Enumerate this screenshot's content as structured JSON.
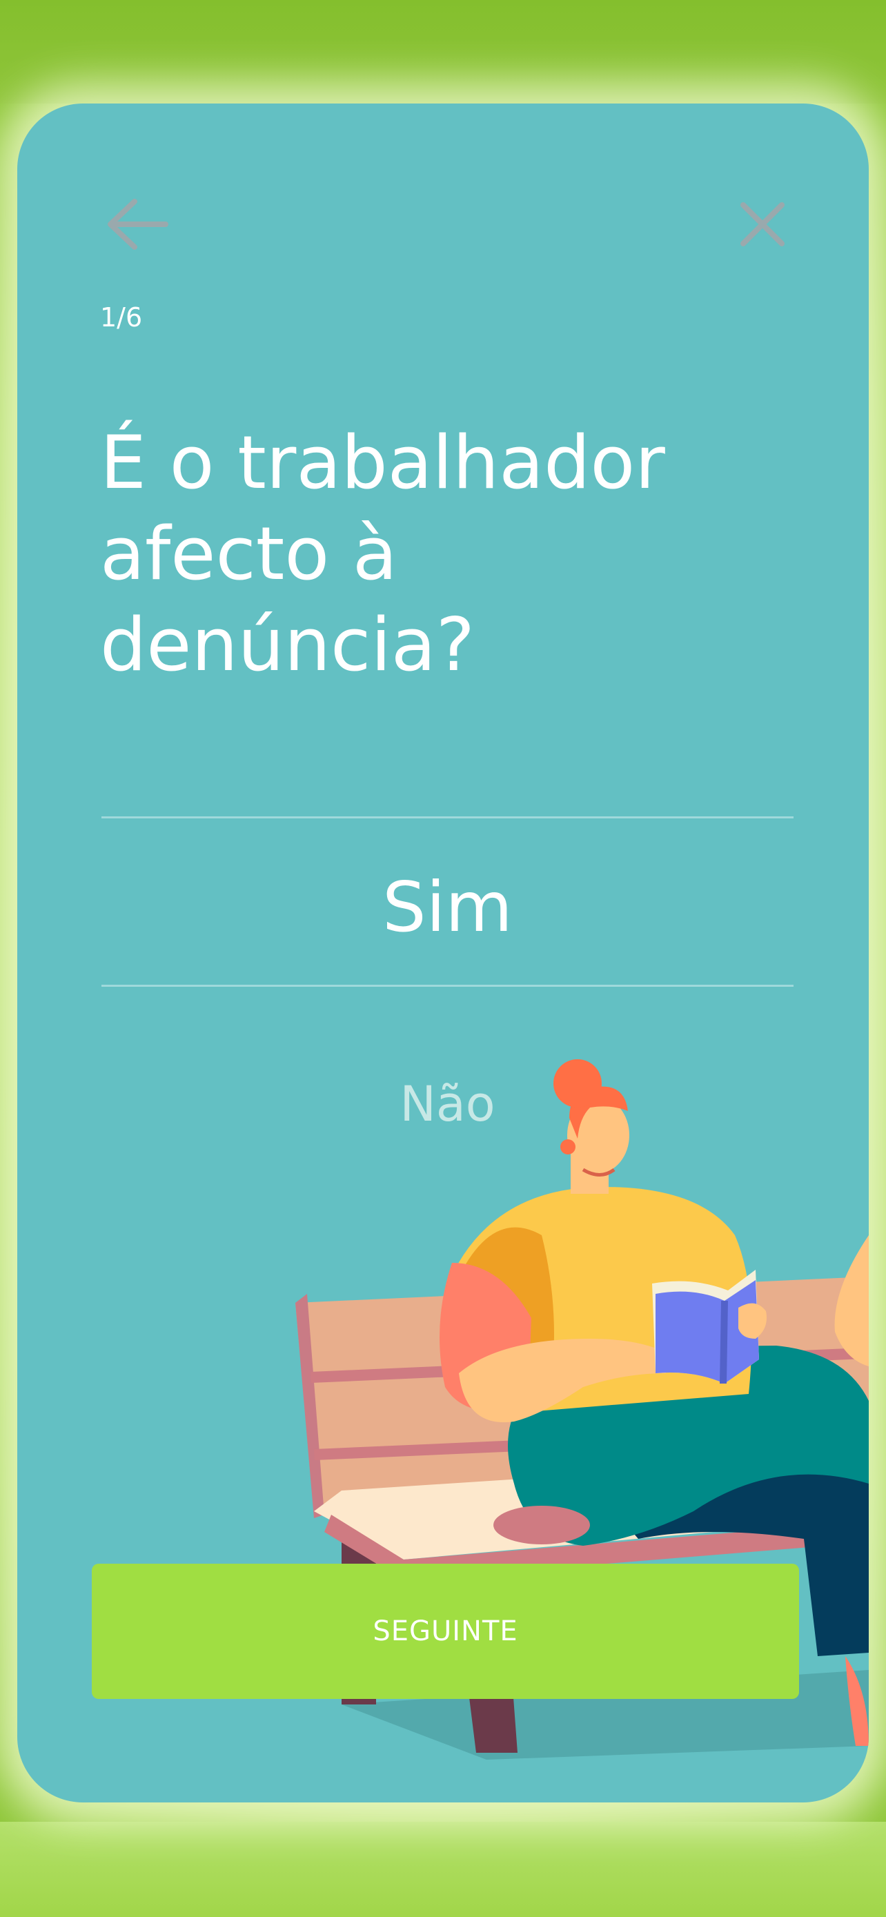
{
  "header": {
    "back_icon": "arrow-left-icon",
    "close_icon": "close-icon",
    "progress": "1/6"
  },
  "question": {
    "line1": "É o trabalhador",
    "line2": "afecto à",
    "line3": "denúncia?"
  },
  "options": [
    {
      "label": "Sim",
      "selected": true
    },
    {
      "label": "Não",
      "selected": false
    }
  ],
  "footer": {
    "next_label": "SEGUINTE"
  },
  "colors": {
    "card_background": "#63c0c3",
    "page_background": "#a9d85a",
    "button": "#a0de42",
    "text": "#ffffff",
    "unselected_option": "#c7e8e6"
  }
}
